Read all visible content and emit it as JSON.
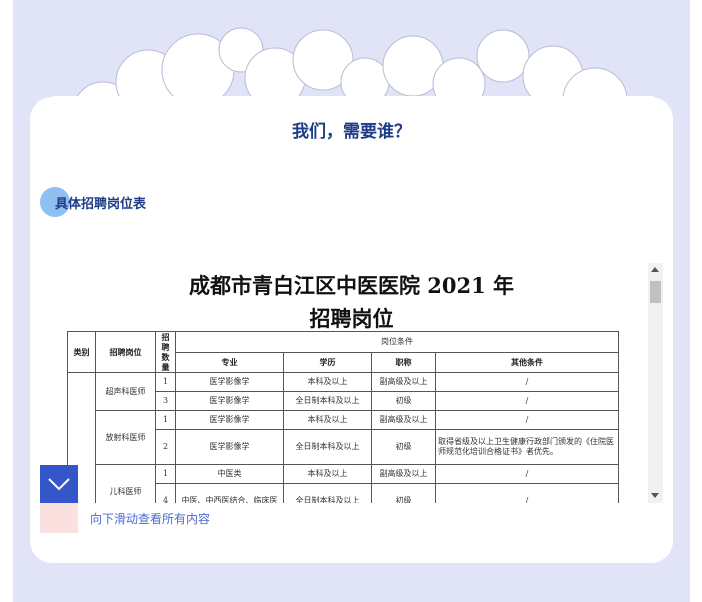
{
  "section": {
    "title": "我们，需要谁？"
  },
  "subheading": "具体招聘岗位表",
  "document": {
    "title_line1": "成都市青白江区中医医院 2021 年",
    "title_line2": "招聘岗位",
    "headers": {
      "category": "类别",
      "position": "招聘岗位",
      "count": "招聘数量",
      "conditions": "岗位条件",
      "major": "专业",
      "education": "学历",
      "title": "职称",
      "other": "其他条件"
    },
    "rows": [
      {
        "count": "1",
        "major": "医学影像学",
        "edu": "本科及以上",
        "title": "副高级及以上",
        "other": "/"
      },
      {
        "count": "3",
        "major": "医学影像学",
        "edu": "全日制本科及以上",
        "title": "初级",
        "other": "/"
      },
      {
        "count": "1",
        "major": "医学影像学",
        "edu": "本科及以上",
        "title": "副高级及以上",
        "other": "/"
      },
      {
        "count": "2",
        "major": "医学影像学",
        "edu": "全日制本科及以上",
        "title": "初级",
        "other": "取得省级及以上卫生健康行政部门颁发的《住院医师规范化培训合格证书》者优先。"
      },
      {
        "count": "1",
        "major": "中医类",
        "edu": "本科及以上",
        "title": "副高级及以上",
        "other": "/"
      },
      {
        "count": "4",
        "major": "中医、中西医结合、临床医",
        "edu": "全日制本科及以上",
        "title": "初级",
        "other": "/"
      }
    ],
    "groups": [
      "超声科医师",
      "放射科医师",
      "儿科医师"
    ]
  },
  "hint": "向下滑动查看所有内容",
  "colors": {
    "background": "#e1e4f6",
    "accent": "#3556c9",
    "highlight": "#f6c23a",
    "title_text": "#1f3c88"
  }
}
